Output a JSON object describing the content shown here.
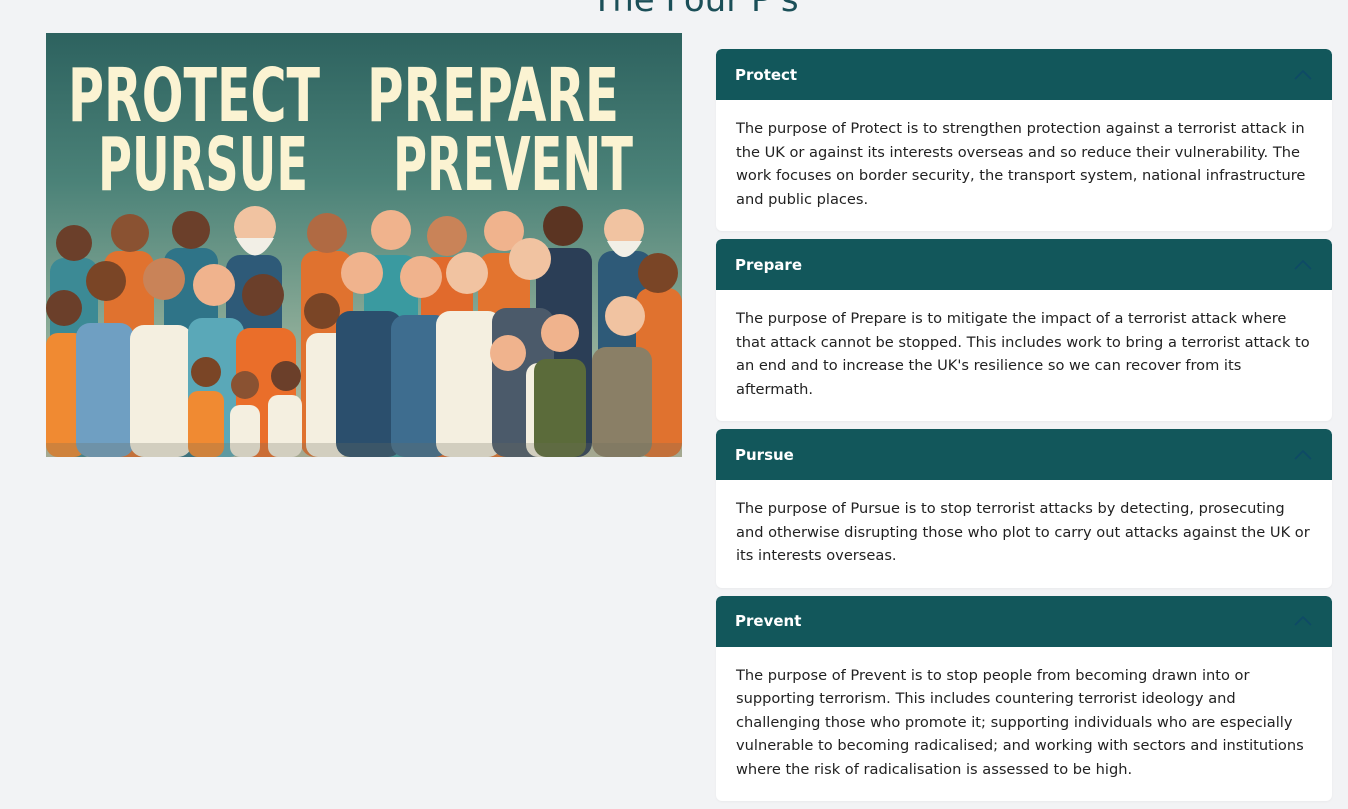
{
  "page": {
    "title": "The Four P's"
  },
  "hero": {
    "words": [
      "PROTECT",
      "PREPARE",
      "PURSUE",
      "PREVENT"
    ]
  },
  "accordion": {
    "items": [
      {
        "title": "Protect",
        "body": "The purpose of Protect is to strengthen protection against a terrorist attack in the UK or against its interests overseas and so reduce their vulnerability. The work focuses on border security, the transport system, national infrastructure and public places."
      },
      {
        "title": "Prepare",
        "body": "The purpose of Prepare is to mitigate the impact of a terrorist attack where that attack cannot be stopped. This includes work to bring a terrorist attack to an end and to increase the UK's resilience so we can recover from its aftermath."
      },
      {
        "title": "Pursue",
        "body": "The purpose of Pursue is to stop terrorist attacks by detecting, prosecuting and otherwise disrupting those who plot to carry out attacks against the UK or its interests overseas."
      },
      {
        "title": "Prevent",
        "body": "The purpose of Prevent is to stop people from becoming drawn into or supporting terrorism. This includes countering terrorist ideology and challenging those who promote it; supporting individuals who are especially vulnerable to becoming radicalised; and working with sectors and institutions where the risk of radicalisation is assessed to be high."
      }
    ]
  },
  "colors": {
    "accent": "#12575b",
    "hero_text": "#fbf3d2",
    "chevron": "#0e4a66",
    "background": "#f2f3f5"
  },
  "icons": {
    "accordion_toggle": "chevron-up-icon"
  }
}
